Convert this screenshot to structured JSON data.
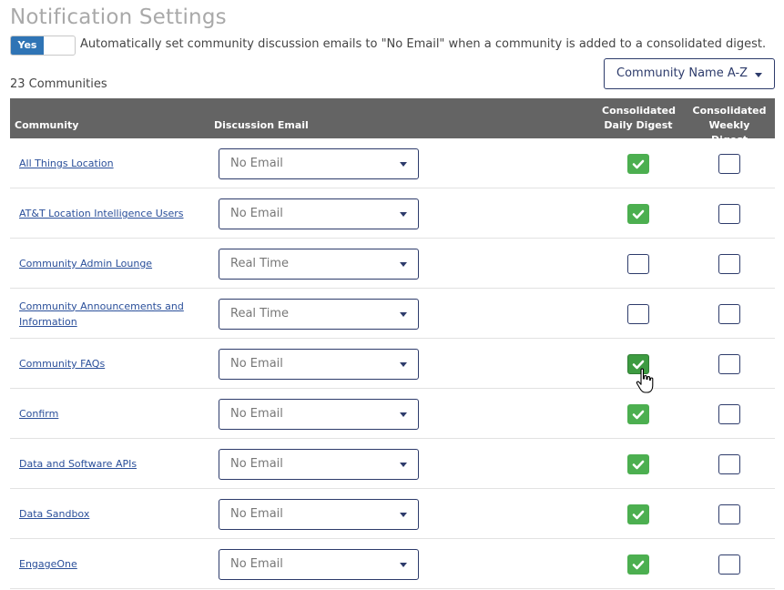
{
  "page": {
    "title": "Notification Settings",
    "toggle_label": "Yes",
    "toggle_description": "Automatically set community discussion emails to \"No Email\" when a community is added to a consolidated digest.",
    "count": "23 Communities",
    "sort_value": "Community Name A-Z"
  },
  "table": {
    "headers": {
      "community": "Community",
      "discussion_email": "Discussion Email",
      "daily_line1": "Consolidated",
      "daily_line2": "Daily Digest",
      "weekly_line1": "Consolidated",
      "weekly_line2": "Weekly Digest"
    },
    "rows": [
      {
        "name": "All Things Location",
        "email": "No Email",
        "daily": true,
        "weekly": false
      },
      {
        "name": "AT&T Location Intelligence Users",
        "email": "No Email",
        "daily": true,
        "weekly": false
      },
      {
        "name": "Community Admin Lounge",
        "email": "Real Time",
        "daily": false,
        "weekly": false
      },
      {
        "name": "Community Announcements and Information",
        "email": "Real Time",
        "daily": false,
        "weekly": false
      },
      {
        "name": "Community FAQs",
        "email": "No Email",
        "daily": true,
        "weekly": false
      },
      {
        "name": "Confirm",
        "email": "No Email",
        "daily": true,
        "weekly": false
      },
      {
        "name": "Data and Software APIs",
        "email": "No Email",
        "daily": true,
        "weekly": false
      },
      {
        "name": "Data Sandbox",
        "email": "No Email",
        "daily": true,
        "weekly": false
      },
      {
        "name": "EngageOne",
        "email": "No Email",
        "daily": true,
        "weekly": false
      }
    ]
  },
  "colors": {
    "accent": "#2f74b5",
    "header_bg": "#646464",
    "checked": "#4caf50",
    "link": "#2a4f9a"
  },
  "icons": {
    "check": "check-icon",
    "caret": "chevron-down-icon",
    "cursor": "hand-pointer-icon"
  }
}
